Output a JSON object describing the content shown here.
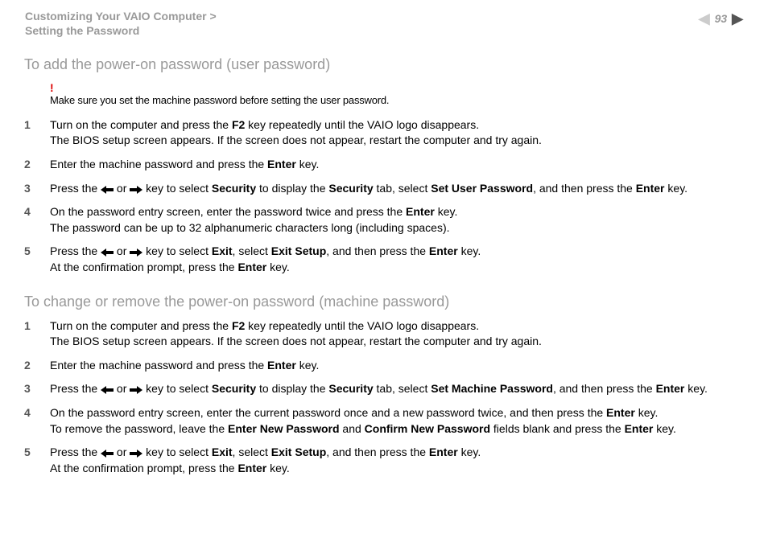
{
  "header": {
    "breadcrumb_line1": "Customizing Your VAIO Computer >",
    "breadcrumb_line2": "Setting the Password",
    "page_number": "93"
  },
  "section1": {
    "title": "To add the power-on password (user password)",
    "warning": "Make sure you set the machine password before setting the user password.",
    "steps": [
      {
        "num": "1",
        "pre": "Turn on the computer and press the ",
        "b1": "F2",
        "post": " key repeatedly until the VAIO logo disappears.",
        "line2": "The BIOS setup screen appears. If the screen does not appear, restart the computer and try again."
      },
      {
        "num": "2",
        "pre": "Enter the machine password and press the ",
        "b1": "Enter",
        "post": " key."
      },
      {
        "num": "3",
        "pre": "Press the ",
        "mid1": " or ",
        "mid2": " key to select ",
        "b1": "Security",
        "mid3": " to display the ",
        "b2": "Security",
        "mid4": " tab, select ",
        "b3": "Set User Password",
        "mid5": ", and then press the ",
        "b4": "Enter",
        "post": " key."
      },
      {
        "num": "4",
        "pre": "On the password entry screen, enter the password twice and press the ",
        "b1": "Enter",
        "post": " key.",
        "line2": "The password can be up to 32 alphanumeric characters long (including spaces)."
      },
      {
        "num": "5",
        "pre": "Press the ",
        "mid1": " or ",
        "mid2": " key to select ",
        "b1": "Exit",
        "mid3": ", select ",
        "b2": "Exit Setup",
        "mid4": ", and then press the ",
        "b3": "Enter",
        "post": " key.",
        "line2pre": "At the confirmation prompt, press the ",
        "line2b": "Enter",
        "line2post": " key."
      }
    ]
  },
  "section2": {
    "title": "To change or remove the power-on password (machine password)",
    "steps": [
      {
        "num": "1",
        "pre": "Turn on the computer and press the ",
        "b1": "F2",
        "post": " key repeatedly until the VAIO logo disappears.",
        "line2": "The BIOS setup screen appears. If the screen does not appear, restart the computer and try again."
      },
      {
        "num": "2",
        "pre": "Enter the machine password and press the ",
        "b1": "Enter",
        "post": " key."
      },
      {
        "num": "3",
        "pre": "Press the ",
        "mid1": " or ",
        "mid2": " key to select ",
        "b1": "Security",
        "mid3": " to display the ",
        "b2": "Security",
        "mid4": " tab, select ",
        "b3": "Set Machine Password",
        "mid5": ", and then press the ",
        "b4": "Enter",
        "post": " key."
      },
      {
        "num": "4",
        "pre": "On the password entry screen, enter the current password once and a new password twice, and then press the ",
        "b1": "Enter",
        "post": " key.",
        "line2pre": "To remove the password, leave the ",
        "line2b1": "Enter New Password",
        "line2mid": " and ",
        "line2b2": "Confirm New Password",
        "line2mid2": " fields blank and press the ",
        "line2b3": "Enter",
        "line2post": " key."
      },
      {
        "num": "5",
        "pre": "Press the ",
        "mid1": " or ",
        "mid2": " key to select ",
        "b1": "Exit",
        "mid3": ", select ",
        "b2": "Exit Setup",
        "mid4": ", and then press the ",
        "b3": "Enter",
        "post": " key.",
        "line2pre": "At the confirmation prompt, press the ",
        "line2b": "Enter",
        "line2post": " key."
      }
    ]
  }
}
